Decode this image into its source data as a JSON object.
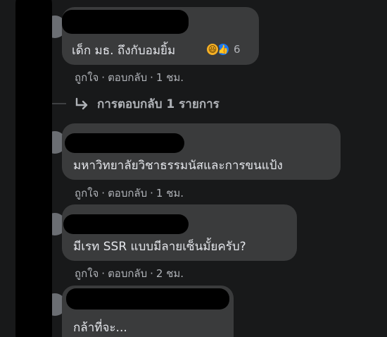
{
  "comments": [
    {
      "text": "เด็ก มธ. ถึงกับอมยิ้ม",
      "actions": {
        "like": "ถูกใจ",
        "reply": "ตอบกลับ",
        "time": "1 ชม."
      },
      "reaction_count": "6"
    },
    {
      "text": "มหาวิทยาลัยวิชาธรรมนัสและการขนแป้ง",
      "actions": {
        "like": "ถูกใจ",
        "reply": "ตอบกลับ",
        "time": "1 ชม."
      }
    },
    {
      "text": "มีเรท SSR แบบมีลายเซ็นมั้ยครับ?",
      "actions": {
        "like": "ถูกใจ",
        "reply": "ตอบกลับ",
        "time": "2 ชม."
      }
    },
    {
      "text": "กล้าที่จะ..."
    }
  ],
  "replies_link": "การตอบกลับ 1 รายการ",
  "separator": "·",
  "colors": {
    "background": "#18191a",
    "bubble": "#3a3b3c",
    "text": "#e4e6eb",
    "secondary": "#b0b3b8",
    "like_blue": "#1877f2",
    "haha_yellow": "#f7b125"
  }
}
